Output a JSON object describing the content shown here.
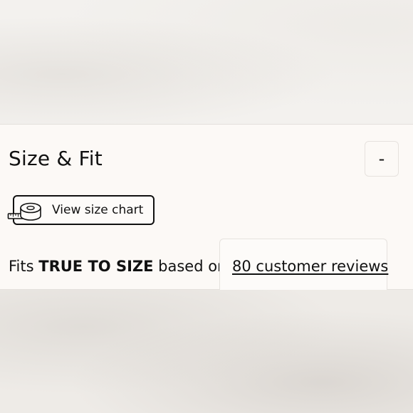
{
  "size_fit": {
    "title": "Size & Fit",
    "collapse_label": "-",
    "size_chart_label": "View size chart",
    "tape_icon": "measuring-tape-icon",
    "fit_prefix": "Fits",
    "fit_value": "TRUE TO SIZE",
    "fit_suffix": "based on",
    "reviews_link": "80 customer reviews"
  },
  "colors": {
    "panel_bg": "#fcf9f6",
    "text": "#111111",
    "border": "#e4e0dc"
  }
}
